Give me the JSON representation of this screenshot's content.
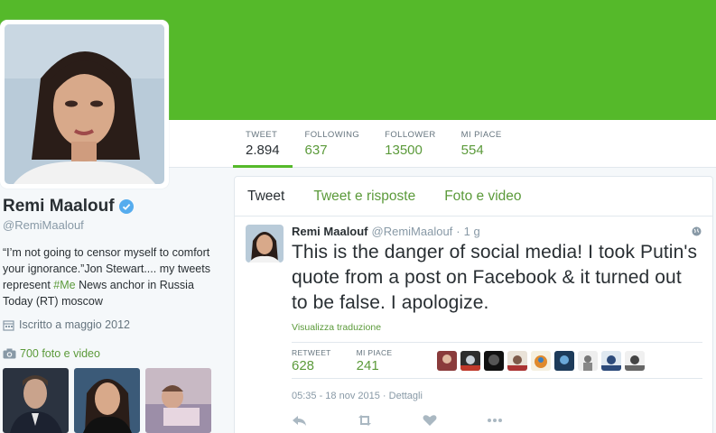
{
  "profile": {
    "name": "Remi Maalouf",
    "handle": "@RemiMaalouf",
    "bio_part1": "“I’m not going to censor myself to comfort your ignorance.”Jon Stewart.... my tweets represent ",
    "bio_hashtag": "#Me",
    "bio_part2": " News anchor in Russia Today (RT) moscow",
    "joined": "Iscritto a maggio 2012",
    "media_link": "700 foto e video"
  },
  "stats": [
    {
      "label": "TWEET",
      "value": "2.894"
    },
    {
      "label": "FOLLOWING",
      "value": "637"
    },
    {
      "label": "FOLLOWER",
      "value": "13500"
    },
    {
      "label": "MI PIACE",
      "value": "554"
    }
  ],
  "tabs": [
    "Tweet",
    "Tweet e risposte",
    "Foto e video"
  ],
  "tweet": {
    "name": "Remi Maalouf",
    "handle": "@RemiMaalouf",
    "separator": "·",
    "time": "1 g",
    "text": "This is the danger of social media! I took Putin's quote from a post on Facebook & it turned out to be false. I apologize.",
    "translate": "Visualizza traduzione",
    "retweet_label": "RETWEET",
    "retweet_count": "628",
    "like_label": "MI PIACE",
    "like_count": "241",
    "date": "05:35 - 18 nov 2015 · Dettagli"
  },
  "colors": {
    "accent": "#55b92a",
    "link": "#5b9a3a",
    "text": "#292f33",
    "muted": "#8899a6"
  }
}
